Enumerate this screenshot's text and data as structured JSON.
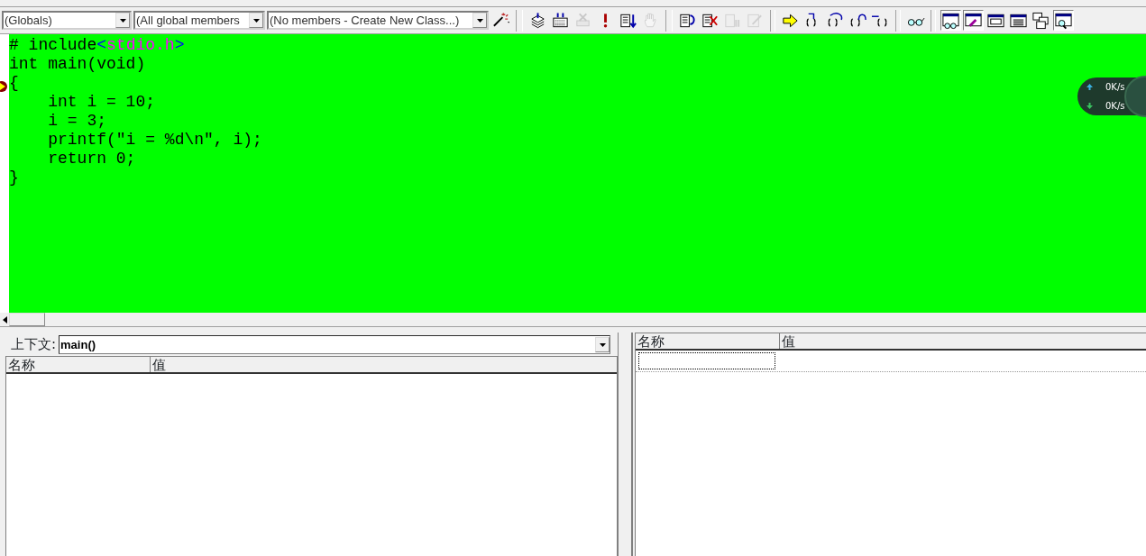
{
  "toolbar": {
    "combos": [
      {
        "value": "(Globals)"
      },
      {
        "value": "(All global members"
      },
      {
        "value": "(No members - Create New Class...)"
      }
    ],
    "buttons": [
      {
        "kind": "wand",
        "disabled": false,
        "pressed": false
      },
      {
        "kind": "compile",
        "disabled": false,
        "pressed": false
      },
      {
        "kind": "build",
        "disabled": false,
        "pressed": false
      },
      {
        "kind": "stop",
        "disabled": true,
        "pressed": false
      },
      {
        "kind": "execute",
        "disabled": false,
        "pressed": false
      },
      {
        "kind": "go",
        "disabled": false,
        "pressed": false
      },
      {
        "kind": "hand",
        "disabled": true,
        "pressed": false
      },
      {
        "kind": "restart",
        "disabled": false,
        "pressed": false
      },
      {
        "kind": "stopdebug",
        "disabled": false,
        "pressed": false
      },
      {
        "kind": "breakall",
        "disabled": true,
        "pressed": false
      },
      {
        "kind": "applycode",
        "disabled": true,
        "pressed": false
      },
      {
        "kind": "shownext",
        "disabled": false,
        "pressed": false
      },
      {
        "kind": "stepinto",
        "disabled": false,
        "pressed": false
      },
      {
        "kind": "stepover",
        "disabled": false,
        "pressed": false
      },
      {
        "kind": "stepout",
        "disabled": false,
        "pressed": false
      },
      {
        "kind": "runcursor",
        "disabled": false,
        "pressed": false
      },
      {
        "kind": "quickwatch",
        "disabled": false,
        "pressed": false
      },
      {
        "kind": "watch",
        "disabled": false,
        "pressed": true
      },
      {
        "kind": "variables",
        "disabled": false,
        "pressed": true
      },
      {
        "kind": "registers",
        "disabled": false,
        "pressed": false
      },
      {
        "kind": "memory",
        "disabled": false,
        "pressed": false
      },
      {
        "kind": "callstack",
        "disabled": false,
        "pressed": false
      },
      {
        "kind": "disasm",
        "disabled": false,
        "pressed": true
      }
    ]
  },
  "editor": {
    "lines": [
      {
        "current": false,
        "tokens": [
          {
            "kind": "plain",
            "text": "# include"
          },
          {
            "kind": "bracket",
            "text": "<"
          },
          {
            "kind": "header",
            "text": "stdio.h"
          },
          {
            "kind": "bracket",
            "text": ">"
          }
        ]
      },
      {
        "current": false,
        "tokens": [
          {
            "kind": "plain",
            "text": "int main(void)"
          }
        ]
      },
      {
        "current": true,
        "tokens": [
          {
            "kind": "plain",
            "text": "{"
          }
        ]
      },
      {
        "current": false,
        "tokens": [
          {
            "kind": "plain",
            "text": "    int i = 10;"
          }
        ]
      },
      {
        "current": false,
        "tokens": [
          {
            "kind": "plain",
            "text": "    i = 3;"
          }
        ]
      },
      {
        "current": false,
        "tokens": [
          {
            "kind": "plain",
            "text": "    printf(\"i = %d\\n\", i);"
          }
        ]
      },
      {
        "current": false,
        "tokens": [
          {
            "kind": "plain",
            "text": "    return 0;"
          }
        ]
      },
      {
        "current": false,
        "tokens": [
          {
            "kind": "plain",
            "text": "}"
          }
        ]
      }
    ]
  },
  "net_widget": {
    "upload": "0K/s",
    "download": "0K/s"
  },
  "variables_pane": {
    "context_label": "上下文:",
    "context_value": "main()",
    "columns": [
      "名称",
      "值"
    ]
  },
  "watch_pane": {
    "columns": [
      "名称",
      "值"
    ]
  }
}
